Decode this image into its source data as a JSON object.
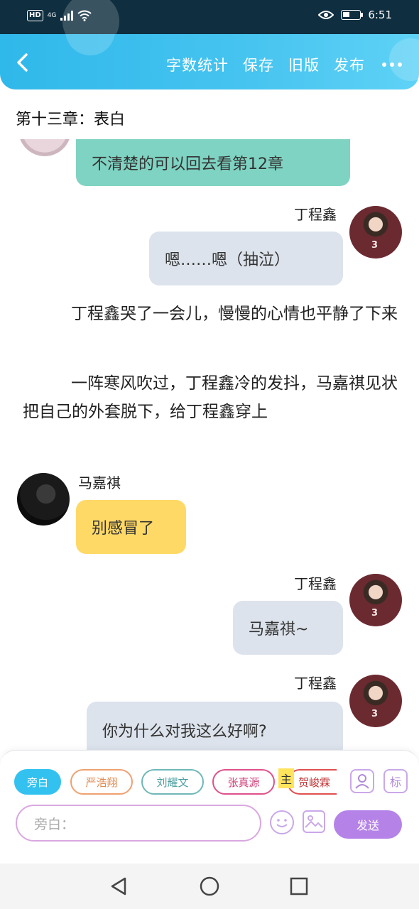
{
  "status_bar": {
    "hd": "HD",
    "network": "4G",
    "time": "6:51",
    "icons": [
      "signal-icon",
      "wifi-icon",
      "eye-icon",
      "battery-icon"
    ]
  },
  "toolbar": {
    "back_icon": "chevron-left-icon",
    "actions": [
      "字数统计",
      "保存",
      "旧版",
      "发布"
    ],
    "more_icon": "more-horizontal-icon"
  },
  "chapter_title": "第十三章：表白",
  "messages": [
    {
      "type": "bubble",
      "side": "left",
      "text": "不清楚的可以回去看第12章",
      "color": "#7fd3c2"
    },
    {
      "type": "bubble",
      "side": "right",
      "speaker": "丁程鑫",
      "text": "嗯……嗯（抽泣）",
      "color": "#dde3ec"
    },
    {
      "type": "narration",
      "text": "丁程鑫哭了一会儿，慢慢的心情也平静了下来"
    },
    {
      "type": "narration",
      "text": "一阵寒风吹过，丁程鑫冷的发抖，马嘉祺见状把自己的外套脱下，给丁程鑫穿上"
    },
    {
      "type": "bubble",
      "side": "left",
      "speaker": "马嘉祺",
      "text": "别感冒了",
      "color": "#ffd966"
    },
    {
      "type": "bubble",
      "side": "right",
      "speaker": "丁程鑫",
      "text": "马嘉祺~",
      "color": "#dde3ec"
    },
    {
      "type": "bubble",
      "side": "right",
      "speaker": "丁程鑫",
      "text": "你为什么对我这么好啊?",
      "color": "#dde3ec"
    }
  ],
  "panel": {
    "chips": [
      "旁白",
      "严浩翔",
      "刘耀文",
      "张真源",
      "贺峻霖"
    ],
    "main_badge": "主",
    "mark_button": "标",
    "input_placeholder": "旁白：",
    "send_label": "发送"
  },
  "nav": [
    "back-triangle-icon",
    "home-circle-icon",
    "recents-square-icon"
  ]
}
